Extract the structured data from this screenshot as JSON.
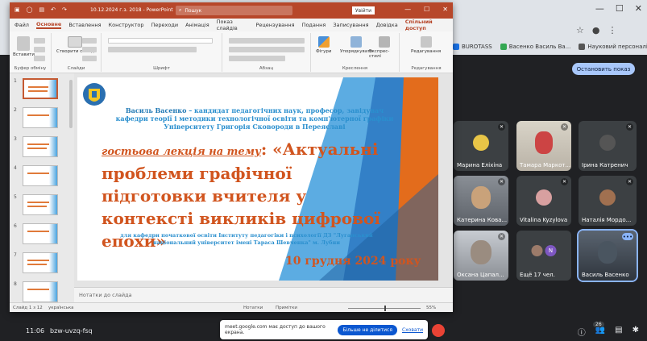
{
  "browser": {
    "bookmarks": [
      {
        "label": "BUROTASS",
        "color": "#1a73e8"
      },
      {
        "label": "Васенко Василь Ва...",
        "color": "#34a853"
      },
      {
        "label": "Науковий персоналій...",
        "color": "#555555"
      }
    ],
    "window_controls": [
      "—",
      "☐",
      "✕"
    ]
  },
  "meet": {
    "stop_show_label": "Остановить показ",
    "clock": "11:06",
    "meeting_code": "bzw-uvzq-fsq",
    "people_badge": "26",
    "share_notice": {
      "text": "meet.google.com має доступ до вашого екрана.",
      "stop_label": "Більше не ділитися",
      "hide_label": "Сховати"
    },
    "tiles": [
      {
        "name": "Марина Еліхіна",
        "avatar_color": "#e8c547"
      },
      {
        "name": "Тамара Маркот...",
        "avatar_color": "#c44"
      },
      {
        "name": "Ірина Катренич",
        "avatar_color": "#555"
      },
      {
        "name": "Катерина Кова...",
        "avatar_color": "#c9a27a"
      },
      {
        "name": "Vitalina Kyzylova",
        "avatar_color": "#d8a0a0"
      },
      {
        "name": "Наталія Мордо...",
        "avatar_color": "#a07050"
      },
      {
        "name": "Оксана Цапал...",
        "avatar_color": "#9a8c80"
      },
      {
        "name": "Ещё 17 чел.",
        "avatar_color": "#5f6368"
      },
      {
        "name": "Василь Васенко",
        "avatar_color": "#4a5560"
      }
    ],
    "extra_initial": "N"
  },
  "ppt": {
    "title_bar": {
      "filename": "10.12.2024 г.з. 2018 - PowerPoint",
      "search_placeholder": "Пошук",
      "signin_label": "Увійти"
    },
    "tabs": [
      "Файл",
      "Основне",
      "Вставлення",
      "Конструктор",
      "Переходи",
      "Анімація",
      "Показ слайдів",
      "Рецензування",
      "Подання",
      "Записування",
      "Довідка"
    ],
    "active_tab": "Основне",
    "share_label": "Спільний доступ",
    "ribbon": {
      "groups": [
        "Буфер обміну",
        "Слайди",
        "Шрифт",
        "Абзац",
        "Креслення",
        "Редагування"
      ],
      "paste_label": "Вставити",
      "new_slide_label": "Створити слайд",
      "shapes_label": "Фігури",
      "arrange_label": "Упорядкувати",
      "styles_label": "Експрес-стилі",
      "editing_label": "Редагування"
    },
    "slide_numbers": [
      "1",
      "2",
      "3",
      "4",
      "5",
      "6",
      "7",
      "8"
    ],
    "selected_slide": "1",
    "slide": {
      "author_name": "Василь Васенко",
      "author_rest": " – кандидат педагогічних наук, професор, завідувач кафедри теорії і методики технологічної освіти та комп'ютерної графіки Університету Григорія Сковороди в Переяславі",
      "lecture_intro": "гостьова лекція на тему",
      "lecture_title": ": «Актуальні проблеми графічної підготовки вчителя у контексті викликів цифрової епохи»",
      "for_text": "для кафедри початкової освіти Інституту педагогіки і психології ДЗ \"Луганський національний університет імені Тараса Шевченка\" м. Лубни",
      "date": "10 грудня 2024 року"
    },
    "notes_placeholder": "Нотатки до слайда",
    "status": {
      "slide_info": "Слайд 1 з 12",
      "language": "українська",
      "notes_btn": "Нотатки",
      "comments_btn": "Примітки",
      "zoom": "55%",
      "zoom_level": 0.55
    },
    "colors": {
      "accent": "#b7472a",
      "slide_orange": "#d1551f",
      "slide_blue": "#2a8fce"
    }
  }
}
